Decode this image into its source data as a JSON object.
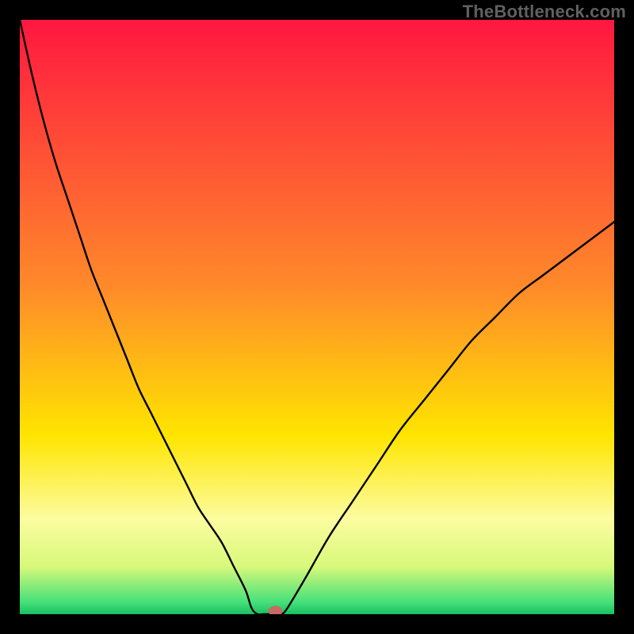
{
  "watermark": "TheBottleneck.com",
  "chart_data": {
    "type": "line",
    "title": "",
    "xlabel": "",
    "ylabel": "",
    "xlim": [
      0,
      100
    ],
    "ylim": [
      0,
      100
    ],
    "x": [
      0,
      2,
      4,
      6,
      8,
      10,
      12,
      14,
      16,
      18,
      20,
      22,
      24,
      26,
      28,
      30,
      32,
      34,
      36,
      38,
      39,
      40,
      41,
      42,
      43,
      44,
      45,
      48,
      52,
      56,
      60,
      64,
      68,
      72,
      76,
      80,
      84,
      88,
      92,
      96,
      100
    ],
    "values": [
      100,
      91,
      83,
      76,
      70,
      64,
      58,
      53,
      48,
      43,
      38,
      34,
      30,
      26,
      22,
      18,
      15,
      12,
      8,
      4,
      1,
      0,
      0,
      0,
      0,
      0,
      1,
      6,
      13,
      19,
      25,
      31,
      36,
      41,
      46,
      50,
      54,
      57,
      60,
      63,
      66
    ],
    "marker": {
      "x": 43,
      "y": 0
    },
    "gradient_stops": [
      {
        "pos": 0.0,
        "color": "#ff1740"
      },
      {
        "pos": 0.45,
        "color": "#ff8a2a"
      },
      {
        "pos": 0.7,
        "color": "#ffe500"
      },
      {
        "pos": 0.84,
        "color": "#fcfca0"
      },
      {
        "pos": 0.92,
        "color": "#d7f97a"
      },
      {
        "pos": 0.98,
        "color": "#45e07a"
      },
      {
        "pos": 1.0,
        "color": "#18c060"
      }
    ]
  }
}
